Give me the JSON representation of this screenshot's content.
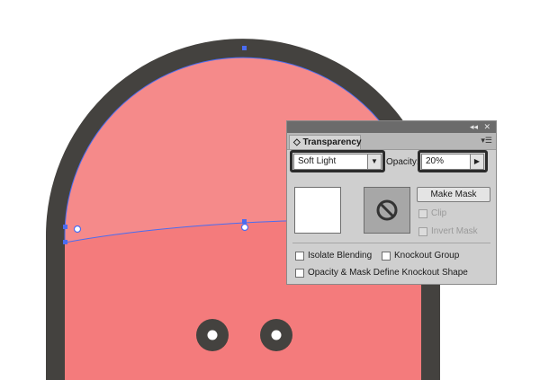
{
  "colors": {
    "outline": "#44423f",
    "fill_upper": "#f58a8a",
    "fill_lower": "#f47b7c",
    "selection": "#4a6cf0",
    "panel_bg": "#cfcfcf",
    "panel_titlebar": "#6b6b6b"
  },
  "panel": {
    "collapse_icon": "double-chevron-icon",
    "close_icon": "close-icon",
    "tab_label": "Transparency",
    "menu_icon": "panel-menu-icon",
    "blend_mode": "Soft Light",
    "opacity_label": "Opacity:",
    "opacity_value": "20%",
    "make_mask_label": "Make Mask",
    "clip_label": "Clip",
    "invert_mask_label": "Invert Mask",
    "isolate_blending_label": "Isolate Blending",
    "knockout_group_label": "Knockout Group",
    "opacity_mask_label": "Opacity & Mask Define Knockout Shape"
  }
}
